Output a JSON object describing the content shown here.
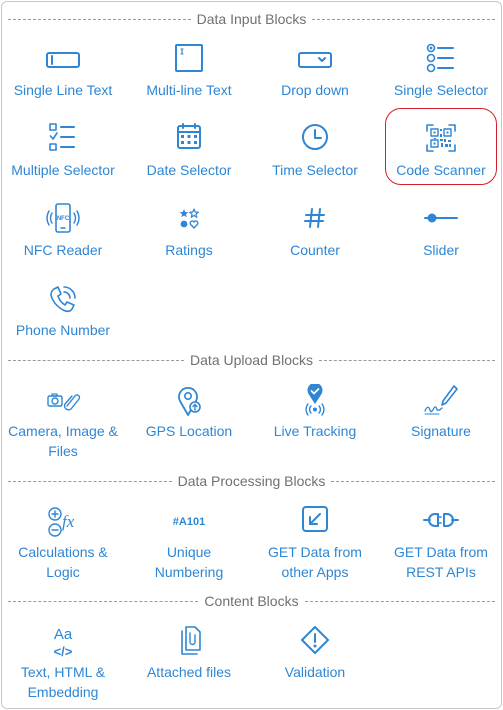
{
  "sections": [
    {
      "title": "Data Input Blocks"
    },
    {
      "title": "Data Upload Blocks"
    },
    {
      "title": "Data Processing Blocks"
    },
    {
      "title": "Content Blocks"
    }
  ],
  "blocks": {
    "single_line_text": {
      "label": "Single Line Text",
      "icon": "text-field-icon"
    },
    "multi_line_text": {
      "label": "Multi-line Text",
      "icon": "text-area-icon"
    },
    "drop_down": {
      "label": "Drop down",
      "icon": "dropdown-icon"
    },
    "single_selector": {
      "label": "Single Selector",
      "icon": "radio-list-icon"
    },
    "multiple_selector": {
      "label": "Multiple Selector",
      "icon": "checklist-icon"
    },
    "date_selector": {
      "label": "Date Selector",
      "icon": "calendar-icon"
    },
    "time_selector": {
      "label": "Time Selector",
      "icon": "clock-icon"
    },
    "code_scanner": {
      "label": "Code Scanner",
      "icon": "qr-code-icon"
    },
    "nfc_reader": {
      "label": "NFC Reader",
      "icon": "nfc-phone-icon"
    },
    "ratings": {
      "label": "Ratings",
      "icon": "ratings-icon"
    },
    "counter": {
      "label": "Counter",
      "icon": "hash-icon"
    },
    "slider": {
      "label": "Slider",
      "icon": "slider-icon"
    },
    "phone_number": {
      "label": "Phone Number",
      "icon": "phone-icon"
    },
    "camera_image_files": {
      "label_line1": "Camera, Image &",
      "label_line2": "Files",
      "icon": "camera-clip-icon"
    },
    "gps_location": {
      "label": "GPS Location",
      "icon": "map-pin-icon"
    },
    "live_tracking": {
      "label": "Live Tracking",
      "icon": "tracking-pin-icon"
    },
    "signature": {
      "label": "Signature",
      "icon": "pen-signature-icon"
    },
    "calculations_logic": {
      "label_line1": "Calculations &",
      "label_line2": "Logic",
      "icon": "calculator-fx-icon"
    },
    "unique_numbering": {
      "label_line1": "Unique",
      "label_line2": "Numbering",
      "icon_text": "#A101",
      "icon": "numbering-icon"
    },
    "get_data_other_apps": {
      "label_line1": "GET Data from",
      "label_line2": "other Apps",
      "icon": "import-arrow-icon"
    },
    "get_data_rest_apis": {
      "label_line1": "GET Data from",
      "label_line2": "REST APIs",
      "icon": "plug-connector-icon"
    },
    "text_html_embedding": {
      "label_line1": "Text, HTML &",
      "label_line2": "Embedding",
      "icon_text": "Aa",
      "icon_code": "</>",
      "icon": "text-html-icon"
    },
    "attached_files": {
      "label": "Attached files",
      "icon": "files-icon"
    },
    "validation": {
      "label": "Validation",
      "icon": "warning-diamond-icon"
    }
  },
  "colors": {
    "accent": "#2e86d4",
    "section_text": "#707070",
    "highlight": "#d21f2c",
    "border": "#c9c9c9"
  }
}
